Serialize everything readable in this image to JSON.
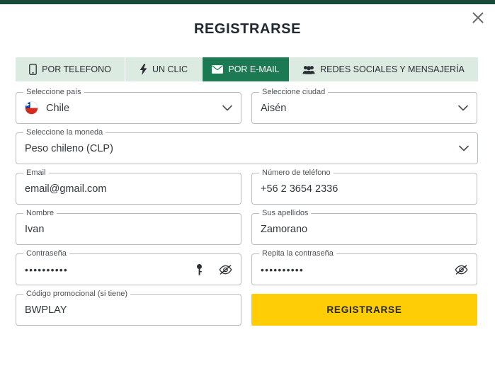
{
  "window": {
    "title": "REGISTRARSE",
    "close_icon": "close-icon",
    "accent_green": "#184A3A",
    "active_tab_green": "#1B7A51",
    "tabs_bg": "#DCEBE2",
    "submit_yellow": "#FFCD05"
  },
  "tabs": [
    {
      "label": "POR TELEFONO",
      "icon": "phone-icon",
      "active": false
    },
    {
      "label": "UN CLIC",
      "icon": "lightning-icon",
      "active": false
    },
    {
      "label": "POR E-MAIL",
      "icon": "envelope-icon",
      "active": true
    },
    {
      "label": "REDES SOCIALES Y MENSAJERÍA",
      "icon": "people-icon",
      "active": false
    }
  ],
  "form": {
    "country": {
      "label": "Seleccione país",
      "value": "Chile",
      "flag": "chile-flag-icon",
      "chevron": "chevron-down-icon"
    },
    "city": {
      "label": "Seleccione ciudad",
      "value": "Aisén",
      "chevron": "chevron-down-icon"
    },
    "currency": {
      "label": "Seleccione la moneda",
      "value": "Peso chileno (CLP)",
      "chevron": "chevron-down-icon"
    },
    "email": {
      "label": "Email",
      "value": "email@gmail.com",
      "placeholder": ""
    },
    "phone": {
      "label": "Número de teléfono",
      "value": "+56  2 3654 2336",
      "placeholder": ""
    },
    "first_name": {
      "label": "Nombre",
      "value": "Ivan",
      "placeholder": ""
    },
    "last_name": {
      "label": "Sus apellidos",
      "value": "Zamorano",
      "placeholder": ""
    },
    "password": {
      "label": "Contraseña",
      "value": "••••••••••",
      "key_icon": "key-icon",
      "eye_icon": "eye-off-icon"
    },
    "password_repeat": {
      "label": "Repita la contraseña",
      "value": "••••••••••",
      "eye_icon": "eye-off-icon"
    },
    "promo": {
      "label": "Código promocional (si tiene)",
      "value": "BWPLAY",
      "placeholder": ""
    },
    "submit": {
      "label": "REGISTRARSE"
    }
  }
}
